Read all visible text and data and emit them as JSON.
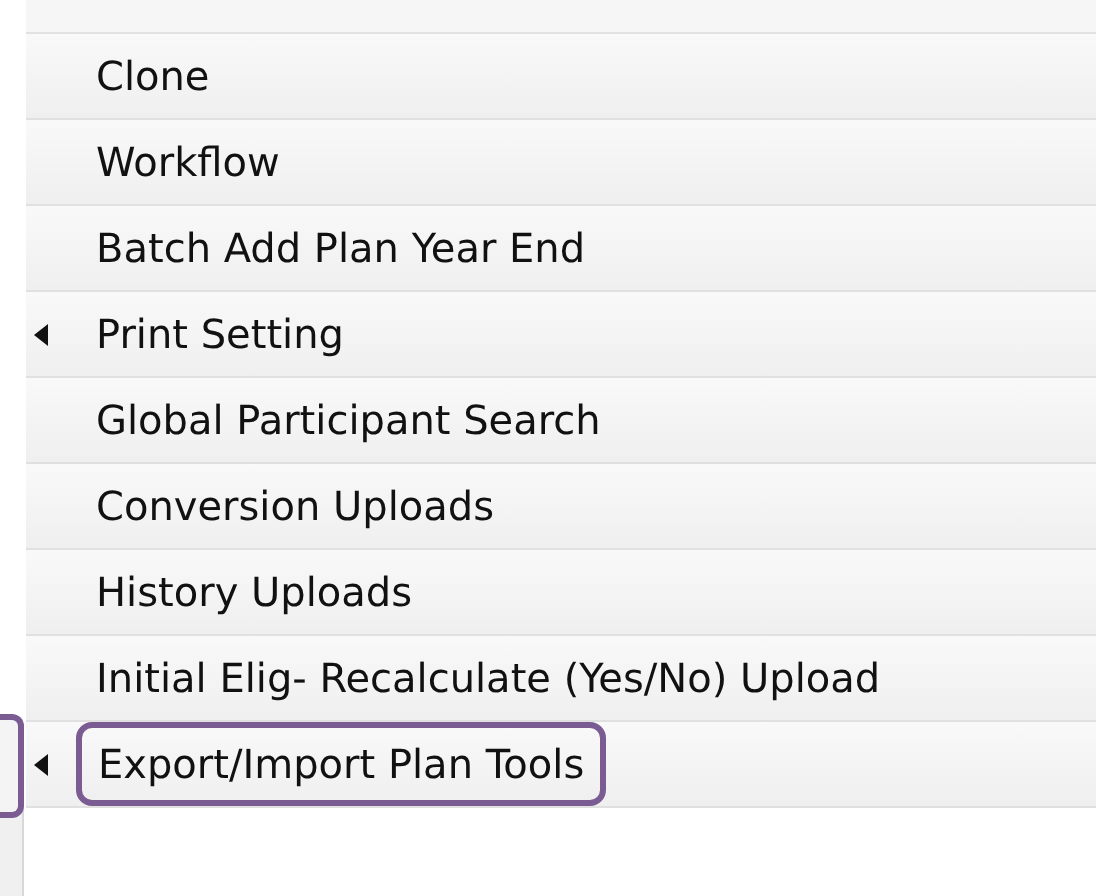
{
  "menu": {
    "items": [
      {
        "label": "Clone",
        "submenu": false,
        "highlighted": false
      },
      {
        "label": "Workflow",
        "submenu": false,
        "highlighted": false
      },
      {
        "label": "Batch Add Plan Year End",
        "submenu": false,
        "highlighted": false
      },
      {
        "label": "Print Setting",
        "submenu": true,
        "highlighted": false
      },
      {
        "label": "Global Participant Search",
        "submenu": false,
        "highlighted": false
      },
      {
        "label": "Conversion Uploads",
        "submenu": false,
        "highlighted": false
      },
      {
        "label": "History Uploads",
        "submenu": false,
        "highlighted": false
      },
      {
        "label": "Initial Elig- Recalculate (Yes/No) Upload",
        "submenu": false,
        "highlighted": false
      },
      {
        "label": "Export/Import Plan Tools",
        "submenu": true,
        "highlighted": true
      }
    ]
  }
}
